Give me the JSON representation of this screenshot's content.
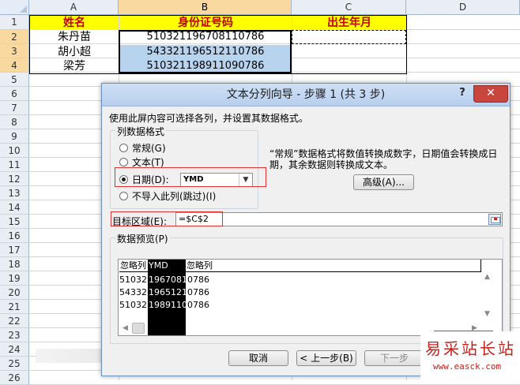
{
  "sheet": {
    "columns": [
      "A",
      "B",
      "C",
      "D"
    ],
    "rows": [
      "1",
      "2",
      "3",
      "4",
      "5",
      "6",
      "7",
      "8",
      "9",
      "10",
      "11",
      "12",
      "13",
      "14",
      "15",
      "16",
      "17",
      "18",
      "19",
      "20",
      "21",
      "22",
      "23",
      "24",
      "25",
      "26"
    ],
    "headers": {
      "a": "姓名",
      "b": "身份证号码",
      "c": "出生年月"
    },
    "data": [
      {
        "name": "朱丹苗",
        "id": "510321196708110786"
      },
      {
        "name": "胡小超",
        "id": "543321196512110786"
      },
      {
        "name": "梁芳",
        "id": "510321198911090786"
      }
    ],
    "colors": {
      "header_fill": "#ffff00",
      "header_text": "#c00000",
      "selection": "#b8d3ee"
    }
  },
  "dialog": {
    "title": "文本分列向导 - 步骤 1 (共 3 步)",
    "help": "?",
    "close": "✕",
    "instruction": "使用此屏内容可选择各列，并设置其数据格式。",
    "column_format_group": "列数据格式",
    "options": [
      {
        "label": "常规(G)",
        "selected": false
      },
      {
        "label": "文本(T)",
        "selected": false
      },
      {
        "label": "日期(D):",
        "selected": true
      },
      {
        "label": "不导入此列(跳过)(I)",
        "selected": false
      }
    ],
    "date_format": "YMD",
    "description": "“常规”数据格式将数值转换成数字，日期值会转换成日期，其余数据则转换成文本。",
    "advanced_button": "高级(A)...",
    "destination_label": "目标区域(E):",
    "destination_value": "=$C$2",
    "preview_label": "数据预览(P)",
    "preview": {
      "columns": [
        "忽略列",
        "YMD",
        "忽略列"
      ],
      "rows": [
        [
          "510321",
          "19670811",
          "0786"
        ],
        [
          "543321",
          "19651211",
          "0786"
        ],
        [
          "510321",
          "19891109",
          "0786"
        ]
      ]
    },
    "buttons": {
      "cancel": "取消",
      "back": "< 上一步(B)",
      "next": "下一步"
    }
  },
  "watermark": {
    "text": "易采站长站",
    "url": "www.easck.com"
  }
}
